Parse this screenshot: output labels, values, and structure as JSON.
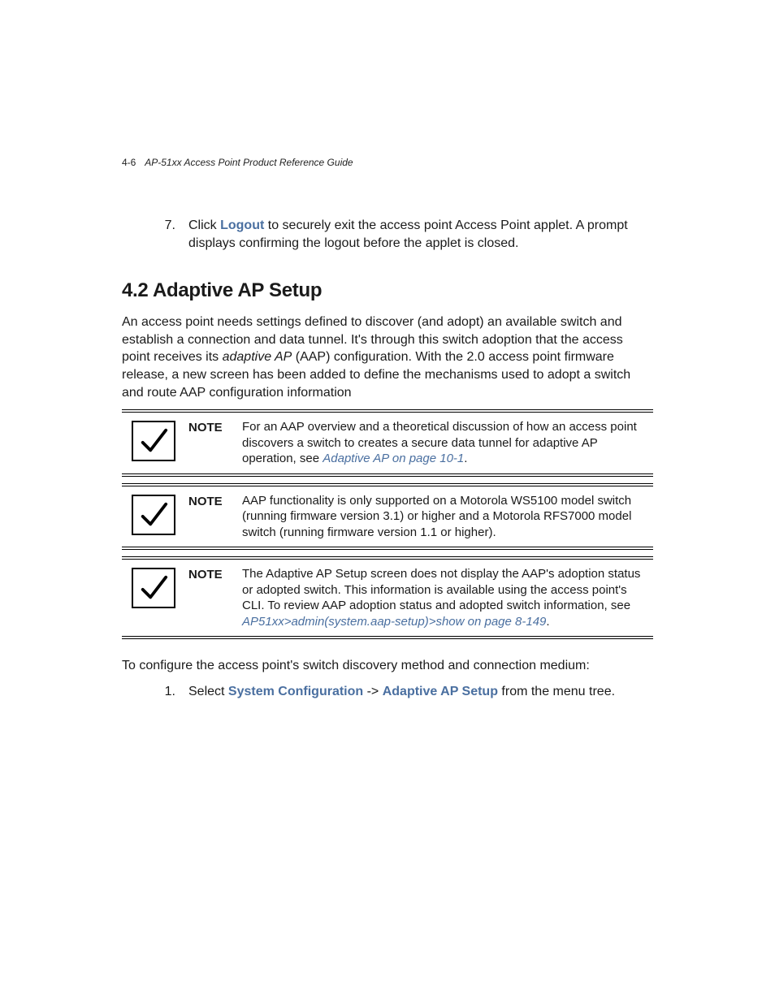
{
  "header": {
    "page_number": "4-6",
    "title": "AP-51xx Access Point Product Reference Guide"
  },
  "step7": {
    "number": "7.",
    "prefix": "Click ",
    "strong": "Logout",
    "suffix": " to securely exit the access point Access Point applet. A prompt displays confirming the logout before the applet is closed."
  },
  "section": {
    "heading": "4.2 Adaptive AP Setup",
    "p1_a": "An access point needs settings defined to discover (and adopt) an available switch and establish a connection and data tunnel. It's through this switch adoption that the access point receives its ",
    "p1_em": "adaptive AP",
    "p1_b": " (AAP) configuration. With the 2.0 access point firmware release, a new screen has been added to define the mechanisms used to adopt a switch and route AAP configuration information"
  },
  "notes": [
    {
      "label": "NOTE",
      "text_a": "For an AAP overview and a theoretical discussion of how an access point discovers a switch to creates a secure data tunnel for adaptive AP operation, see ",
      "link": "Adaptive AP on page 10-1",
      "text_b": "."
    },
    {
      "label": "NOTE",
      "text_a": "AAP functionality is only supported on a Motorola WS5100 model switch (running firmware version 3.1) or higher and a Motorola RFS7000 model switch (running firmware version 1.1 or higher).",
      "link": "",
      "text_b": ""
    },
    {
      "label": "NOTE",
      "text_a": "The Adaptive AP Setup screen does not display the AAP's adoption status or adopted switch. This information is available using the access point's CLI. To review AAP adoption status and adopted switch information, see ",
      "link": "AP51xx>admin(system.aap-setup)>show on page 8-149",
      "text_b": "."
    }
  ],
  "post_note": "To configure the access point's switch discovery method and connection medium:",
  "step1": {
    "number": "1.",
    "prefix": "Select ",
    "strong1": "System Configuration",
    "middle": " -> ",
    "strong2": "Adaptive AP Setup",
    "suffix": " from the menu tree."
  }
}
